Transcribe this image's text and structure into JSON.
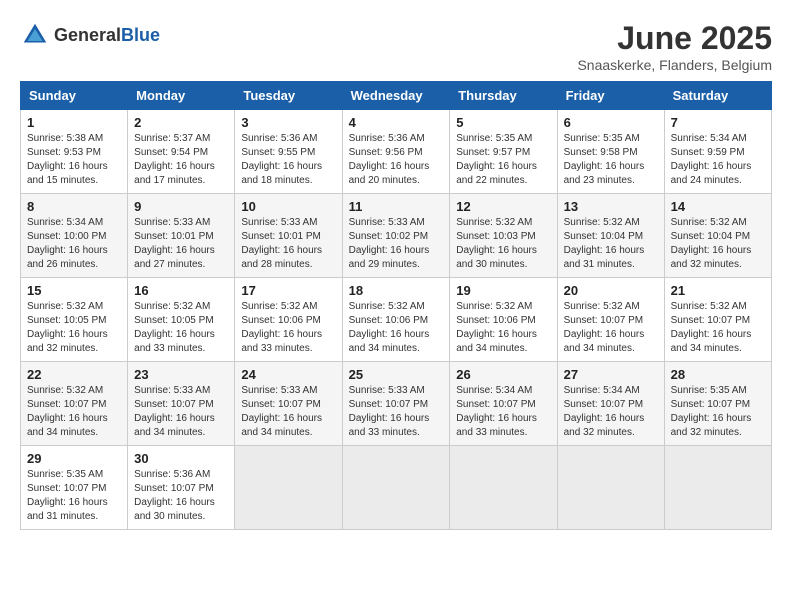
{
  "header": {
    "logo_general": "General",
    "logo_blue": "Blue",
    "month_title": "June 2025",
    "location": "Snaaskerke, Flanders, Belgium"
  },
  "weekdays": [
    "Sunday",
    "Monday",
    "Tuesday",
    "Wednesday",
    "Thursday",
    "Friday",
    "Saturday"
  ],
  "weeks": [
    [
      {
        "day": "1",
        "sunrise": "Sunrise: 5:38 AM",
        "sunset": "Sunset: 9:53 PM",
        "daylight": "Daylight: 16 hours and 15 minutes."
      },
      {
        "day": "2",
        "sunrise": "Sunrise: 5:37 AM",
        "sunset": "Sunset: 9:54 PM",
        "daylight": "Daylight: 16 hours and 17 minutes."
      },
      {
        "day": "3",
        "sunrise": "Sunrise: 5:36 AM",
        "sunset": "Sunset: 9:55 PM",
        "daylight": "Daylight: 16 hours and 18 minutes."
      },
      {
        "day": "4",
        "sunrise": "Sunrise: 5:36 AM",
        "sunset": "Sunset: 9:56 PM",
        "daylight": "Daylight: 16 hours and 20 minutes."
      },
      {
        "day": "5",
        "sunrise": "Sunrise: 5:35 AM",
        "sunset": "Sunset: 9:57 PM",
        "daylight": "Daylight: 16 hours and 22 minutes."
      },
      {
        "day": "6",
        "sunrise": "Sunrise: 5:35 AM",
        "sunset": "Sunset: 9:58 PM",
        "daylight": "Daylight: 16 hours and 23 minutes."
      },
      {
        "day": "7",
        "sunrise": "Sunrise: 5:34 AM",
        "sunset": "Sunset: 9:59 PM",
        "daylight": "Daylight: 16 hours and 24 minutes."
      }
    ],
    [
      {
        "day": "8",
        "sunrise": "Sunrise: 5:34 AM",
        "sunset": "Sunset: 10:00 PM",
        "daylight": "Daylight: 16 hours and 26 minutes."
      },
      {
        "day": "9",
        "sunrise": "Sunrise: 5:33 AM",
        "sunset": "Sunset: 10:01 PM",
        "daylight": "Daylight: 16 hours and 27 minutes."
      },
      {
        "day": "10",
        "sunrise": "Sunrise: 5:33 AM",
        "sunset": "Sunset: 10:01 PM",
        "daylight": "Daylight: 16 hours and 28 minutes."
      },
      {
        "day": "11",
        "sunrise": "Sunrise: 5:33 AM",
        "sunset": "Sunset: 10:02 PM",
        "daylight": "Daylight: 16 hours and 29 minutes."
      },
      {
        "day": "12",
        "sunrise": "Sunrise: 5:32 AM",
        "sunset": "Sunset: 10:03 PM",
        "daylight": "Daylight: 16 hours and 30 minutes."
      },
      {
        "day": "13",
        "sunrise": "Sunrise: 5:32 AM",
        "sunset": "Sunset: 10:04 PM",
        "daylight": "Daylight: 16 hours and 31 minutes."
      },
      {
        "day": "14",
        "sunrise": "Sunrise: 5:32 AM",
        "sunset": "Sunset: 10:04 PM",
        "daylight": "Daylight: 16 hours and 32 minutes."
      }
    ],
    [
      {
        "day": "15",
        "sunrise": "Sunrise: 5:32 AM",
        "sunset": "Sunset: 10:05 PM",
        "daylight": "Daylight: 16 hours and 32 minutes."
      },
      {
        "day": "16",
        "sunrise": "Sunrise: 5:32 AM",
        "sunset": "Sunset: 10:05 PM",
        "daylight": "Daylight: 16 hours and 33 minutes."
      },
      {
        "day": "17",
        "sunrise": "Sunrise: 5:32 AM",
        "sunset": "Sunset: 10:06 PM",
        "daylight": "Daylight: 16 hours and 33 minutes."
      },
      {
        "day": "18",
        "sunrise": "Sunrise: 5:32 AM",
        "sunset": "Sunset: 10:06 PM",
        "daylight": "Daylight: 16 hours and 34 minutes."
      },
      {
        "day": "19",
        "sunrise": "Sunrise: 5:32 AM",
        "sunset": "Sunset: 10:06 PM",
        "daylight": "Daylight: 16 hours and 34 minutes."
      },
      {
        "day": "20",
        "sunrise": "Sunrise: 5:32 AM",
        "sunset": "Sunset: 10:07 PM",
        "daylight": "Daylight: 16 hours and 34 minutes."
      },
      {
        "day": "21",
        "sunrise": "Sunrise: 5:32 AM",
        "sunset": "Sunset: 10:07 PM",
        "daylight": "Daylight: 16 hours and 34 minutes."
      }
    ],
    [
      {
        "day": "22",
        "sunrise": "Sunrise: 5:32 AM",
        "sunset": "Sunset: 10:07 PM",
        "daylight": "Daylight: 16 hours and 34 minutes."
      },
      {
        "day": "23",
        "sunrise": "Sunrise: 5:33 AM",
        "sunset": "Sunset: 10:07 PM",
        "daylight": "Daylight: 16 hours and 34 minutes."
      },
      {
        "day": "24",
        "sunrise": "Sunrise: 5:33 AM",
        "sunset": "Sunset: 10:07 PM",
        "daylight": "Daylight: 16 hours and 34 minutes."
      },
      {
        "day": "25",
        "sunrise": "Sunrise: 5:33 AM",
        "sunset": "Sunset: 10:07 PM",
        "daylight": "Daylight: 16 hours and 33 minutes."
      },
      {
        "day": "26",
        "sunrise": "Sunrise: 5:34 AM",
        "sunset": "Sunset: 10:07 PM",
        "daylight": "Daylight: 16 hours and 33 minutes."
      },
      {
        "day": "27",
        "sunrise": "Sunrise: 5:34 AM",
        "sunset": "Sunset: 10:07 PM",
        "daylight": "Daylight: 16 hours and 32 minutes."
      },
      {
        "day": "28",
        "sunrise": "Sunrise: 5:35 AM",
        "sunset": "Sunset: 10:07 PM",
        "daylight": "Daylight: 16 hours and 32 minutes."
      }
    ],
    [
      {
        "day": "29",
        "sunrise": "Sunrise: 5:35 AM",
        "sunset": "Sunset: 10:07 PM",
        "daylight": "Daylight: 16 hours and 31 minutes."
      },
      {
        "day": "30",
        "sunrise": "Sunrise: 5:36 AM",
        "sunset": "Sunset: 10:07 PM",
        "daylight": "Daylight: 16 hours and 30 minutes."
      },
      null,
      null,
      null,
      null,
      null
    ]
  ]
}
